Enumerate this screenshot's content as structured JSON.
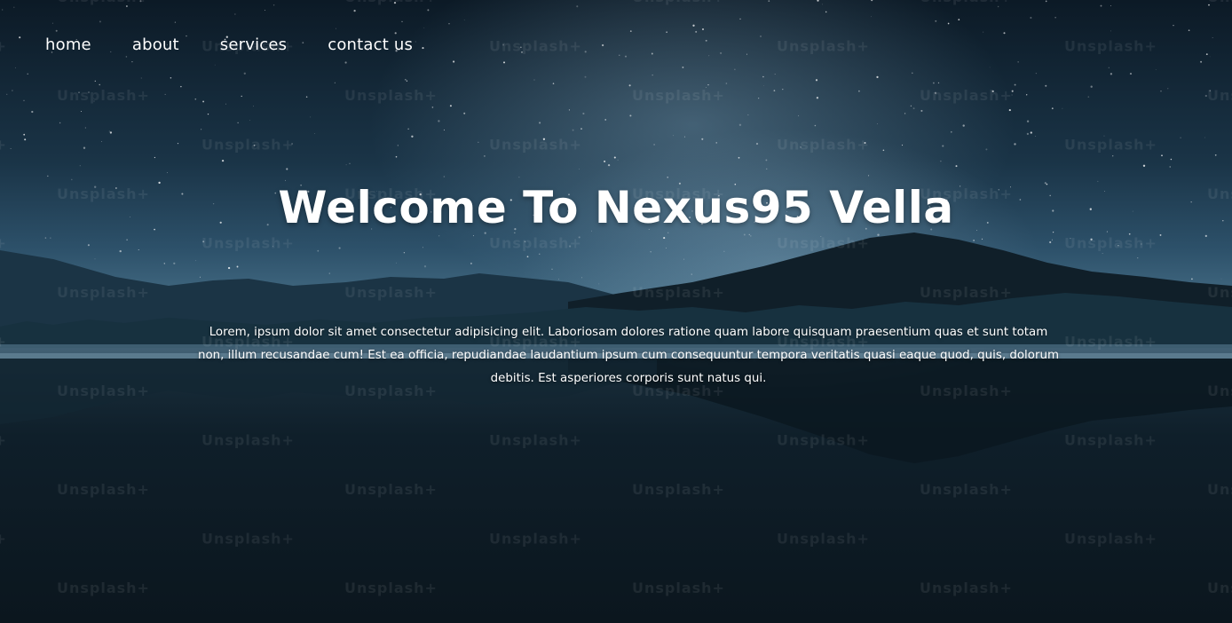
{
  "nav": {
    "items": [
      {
        "label": "home"
      },
      {
        "label": "about"
      },
      {
        "label": "services"
      },
      {
        "label": "contact us"
      }
    ]
  },
  "hero": {
    "title": "Welcome To Nexus95 Vella",
    "description": "Lorem, ipsum dolor sit amet consectetur adipisicing elit. Laboriosam dolores ratione quam labore quisquam praesentium quas et sunt totam non, illum recusandae cum! Est ea officia, repudiandae laudantium ipsum cum consequuntur tempora veritatis quasi eaque quod, quis, dolorum debitis. Est asperiores corporis sunt natus qui."
  },
  "background": {
    "watermark_text": "Unsplash+",
    "sky_color": "#1a3447",
    "water_color": "#0b161e"
  }
}
